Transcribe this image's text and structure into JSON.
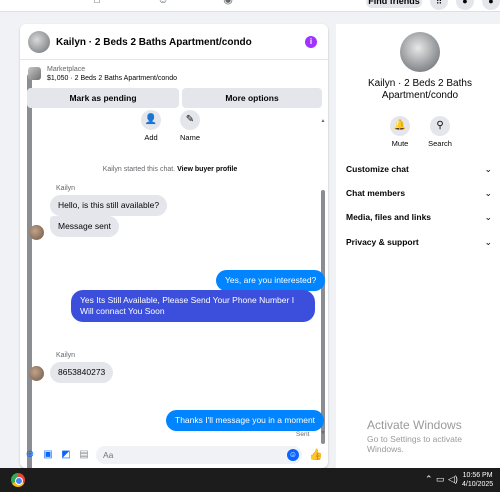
{
  "topnav": {
    "find_friends": "Find friends"
  },
  "chat": {
    "header_title": "Kailyn · 2 Beds 2 Baths Apartment/condo",
    "listing": {
      "category": "Marketplace",
      "title": "$1,050 · 2 Beds 2 Baths Apartment/condo",
      "mark_pending": "Mark as pending",
      "more_options": "More options"
    },
    "actions": [
      {
        "label": "Add",
        "icon": "add-person-icon"
      },
      {
        "label": "Name",
        "icon": "pencil-icon"
      }
    ],
    "system_text": "Kailyn started this chat.",
    "system_link": "View buyer profile",
    "messages": {
      "sender1": "Kailyn",
      "in1": "Hello, is this still available?",
      "in2": "Message sent",
      "out1": "Yes, are you interested?",
      "out2": "Yes Its Still Available, Please Send Your Phone Number I Will connact You Soon",
      "sender2": "Kailyn",
      "in3": "8653840273",
      "out3": "Thanks I'll message you in a moment",
      "sent_status": "Sent"
    },
    "composer": {
      "placeholder": "Aa",
      "icons": [
        "plus-icon",
        "photo-icon",
        "sticker-icon",
        "gif-icon",
        "emoji-icon",
        "thumbs-up-icon"
      ]
    }
  },
  "right_panel": {
    "title": "Kailyn · 2 Beds 2 Baths Apartment/condo",
    "actions": [
      {
        "label": "Mute",
        "icon": "bell-icon"
      },
      {
        "label": "Search",
        "icon": "search-icon"
      }
    ],
    "menu": [
      "Customize chat",
      "Chat members",
      "Media, files and links",
      "Privacy & support"
    ]
  },
  "watermark": {
    "line1": "Activate Windows",
    "line2": "Go to Settings to activate Windows."
  },
  "taskbar": {
    "time": "10:56 PM",
    "date": "4/10/2025"
  }
}
